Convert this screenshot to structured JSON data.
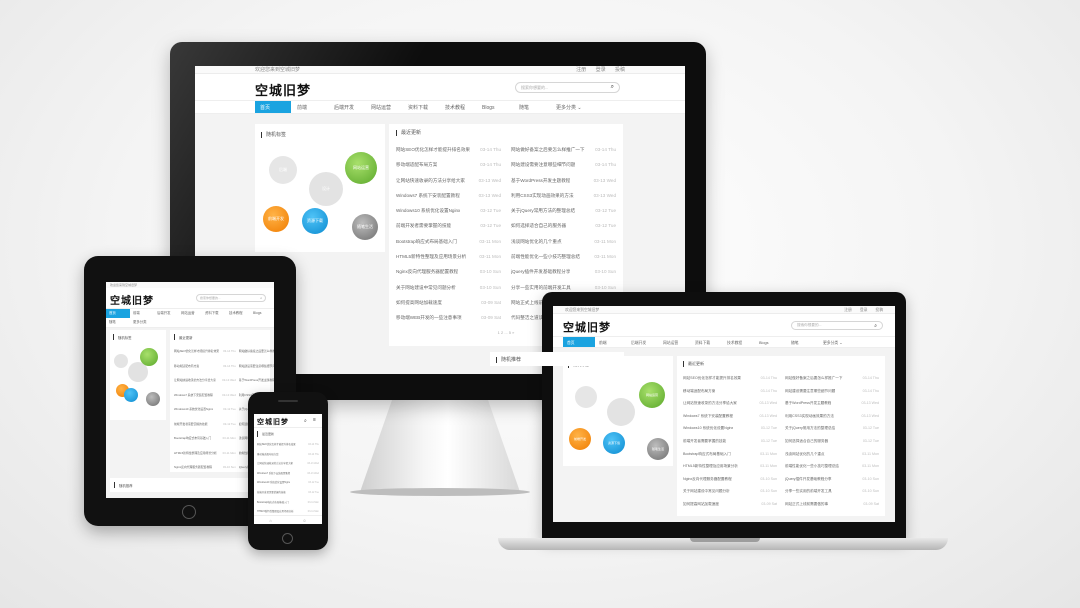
{
  "site": {
    "topbar_left": "欢迎您来到空城旧梦",
    "topbar_links": [
      "注册",
      "登录",
      "投稿"
    ],
    "logo_text": "空城旧梦",
    "search_placeholder": "搜索你想要的...",
    "nav": [
      "首页",
      "前端",
      "后端开发",
      "网站运营",
      "资料下载",
      "技术教程",
      "Blogs",
      "随笔",
      "更多分类"
    ],
    "tag_panel_title": "随机标签",
    "tags": [
      "前端开发",
      "网站运营",
      "资源下载",
      "设计",
      "后端",
      "随笔生活"
    ],
    "latest_title": "最近更新",
    "bottom_panel_title": "随机推荐",
    "list_left": [
      "网站SEO优化怎样才能提升排名效果",
      "移动端适配布局方案",
      "让网站快速收录的方法分享给大家",
      "Windows7 系统下安装配置教程",
      "Windows10 系统优化设置Nginx",
      "前端开发者需要掌握的技能",
      "Bootstrap响应式布局基础入门",
      "HTML5新特性整理及应用场景分析",
      "Nginx反向代理服务器配置教程",
      "关于网站建设中常见问题分析",
      "如何提高网站加载速度",
      "移动端WEB开发的一些注意事项"
    ],
    "list_right": [
      "网站做好备案之后要怎么样推广一下",
      "网站建设需要注意哪些细节问题",
      "基于WordPress开发主题教程",
      "利用CSS3实现动画效果的方法",
      "关于jQuery常用方法的整理总结",
      "如何选择适合自己的服务器",
      "浅谈网站优化的几个重点",
      "前端性能优化一些小技巧整理总结",
      "jQuery插件开发基础教程分享",
      "分享一些实用的前端开发工具",
      "网站正式上线前需要做的事",
      "代码整洁之道读书笔记"
    ],
    "dates": [
      "03-14 Thu",
      "03-14 Thu",
      "03-13 Wed",
      "03-13 Wed",
      "03-12 Tue",
      "03-12 Tue",
      "03-11 Mon",
      "03-11 Mon",
      "03-10 Sun",
      "03-10 Sun",
      "03-09 Sat",
      "03-09 Sat"
    ],
    "pagination": "1 2 ... 5 »"
  },
  "colors": {
    "accent": "#1aa3e0",
    "green": "#7cc242",
    "orange": "#f39c12",
    "gray": "#9a9a9a"
  }
}
